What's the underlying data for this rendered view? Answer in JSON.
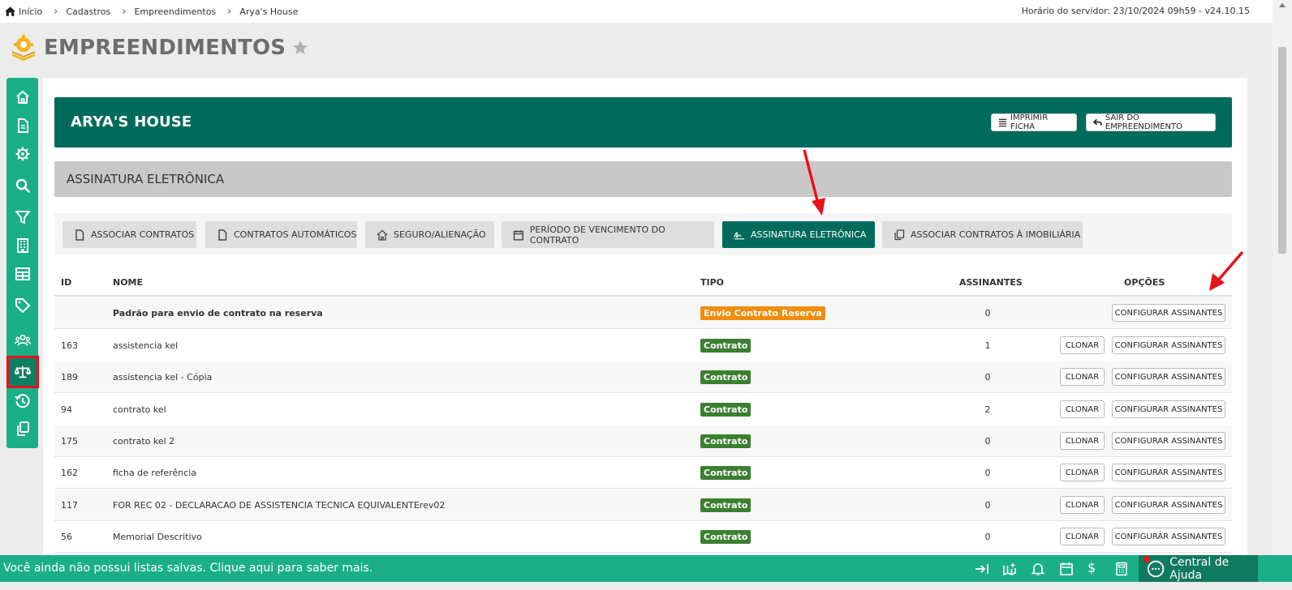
{
  "breadcrumb": {
    "items": [
      "Início",
      "Cadastros",
      "Empreendimentos",
      "Arya's House"
    ]
  },
  "server_info": "Horário do servidor: 23/10/2024 09h59 - v24.10.15",
  "page_title": "EMPREENDIMENTOS",
  "sidebar": {
    "items": [
      "home-icon",
      "document-icon",
      "gear-icon",
      "search-icon",
      "filter-icon",
      "building-icon",
      "table-icon",
      "tag-icon",
      "users-icon",
      "scale-icon",
      "history-icon",
      "copy-icon"
    ],
    "active": "scale-icon"
  },
  "header": {
    "title": "ARYA'S HOUSE",
    "print_label": "IMPRIMIR FICHA",
    "exit_label": "SAIR DO EMPREENDIMENTO"
  },
  "section_title": "ASSINATURA ELETRÔNICA",
  "tabs": [
    {
      "label": "ASSOCIAR CONTRATOS",
      "icon": "file-icon",
      "active": false
    },
    {
      "label": "CONTRATOS AUTOMÁTICOS",
      "icon": "file-icon",
      "active": false
    },
    {
      "label": "SEGURO/ALIENAÇÃO",
      "icon": "house-icon",
      "active": false
    },
    {
      "label": "PERÍODO DE VENCIMENTO DO CONTRATO",
      "icon": "calendar-icon",
      "active": false
    },
    {
      "label": "ASSINATURA ELETRÔNICA",
      "icon": "signature-icon",
      "active": true
    },
    {
      "label": "ASSOCIAR CONTRATOS À IMOBILIÁRIA",
      "icon": "copy-icon",
      "active": false
    }
  ],
  "table": {
    "columns": [
      "ID",
      "NOME",
      "TIPO",
      "ASSINANTES",
      "OPÇÕES"
    ],
    "clone_label": "CLONAR",
    "config_label": "CONFIGURAR ASSINANTES",
    "rows": [
      {
        "id": "",
        "nome": "Padrão para envio de contrato na reserva",
        "tipo": "Envio Contrato Reserva",
        "assinantes": "0"
      },
      {
        "id": "163",
        "nome": "assistencia kel",
        "tipo": "Contrato",
        "assinantes": "1"
      },
      {
        "id": "189",
        "nome": "assistencia kel - Cópia",
        "tipo": "Contrato",
        "assinantes": "0"
      },
      {
        "id": "94",
        "nome": "contrato kel",
        "tipo": "Contrato",
        "assinantes": "2"
      },
      {
        "id": "175",
        "nome": "contrato kel 2",
        "tipo": "Contrato",
        "assinantes": "0"
      },
      {
        "id": "162",
        "nome": "ficha de referência",
        "tipo": "Contrato",
        "assinantes": "0"
      },
      {
        "id": "117",
        "nome": "FOR REC 02 - DECLARACAO DE ASSISTENCIA TECNICA EQUIVALENTErev02",
        "tipo": "Contrato",
        "assinantes": "0"
      },
      {
        "id": "56",
        "nome": "Memorial Descritivo",
        "tipo": "Contrato",
        "assinantes": "0"
      }
    ]
  },
  "bottom_bar": {
    "message": "Você ainda não possui listas salvas. Clique aqui para saber mais.",
    "icons": [
      "export-icon",
      "map-icon",
      "bell-icon",
      "calendar-icon",
      "dollar-icon",
      "calculator-icon"
    ],
    "help_label": "Central de Ajuda"
  },
  "colors": {
    "brand_green": "#1aaf87",
    "dark_green": "#006b5b",
    "badge_contrato": "#3b7f31",
    "badge_reserva": "#f28c0b",
    "annotation_red": "#e8121a"
  }
}
